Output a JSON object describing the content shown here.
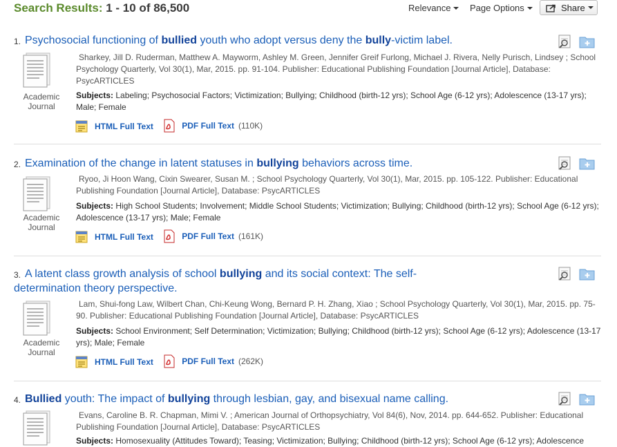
{
  "header": {
    "results_label": "Search Results:",
    "results_range": "1 - 10 of 86,500",
    "relevance": "Relevance",
    "page_options": "Page Options",
    "share": "Share"
  },
  "common": {
    "html_full_text": "HTML Full Text",
    "pdf_full_text": "PDF Full Text",
    "type_line1": "Academic",
    "type_line2": "Journal",
    "subjects_label": "Subjects:"
  },
  "results": [
    {
      "number": "1.",
      "title_parts": [
        "Psychosocial functioning of ",
        "bullied",
        " youth who adopt versus deny the ",
        "bully",
        "-victim label."
      ],
      "meta": "Sharkey, Jill D. Ruderman, Matthew A. Mayworm, Ashley M. Green, Jennifer Greif Furlong, Michael J. Rivera, Nelly Purisch, Lindsey ; School Psychology Quarterly, Vol 30(1), Mar, 2015. pp. 91-104. Publisher: Educational Publishing Foundation [Journal Article], Database: PsycARTICLES",
      "subjects": "Labeling; Psychosocial Factors; Victimization; Bullying; Childhood (birth-12 yrs); School Age (6-12 yrs); Adolescence (13-17 yrs); Male; Female",
      "pdf_size": "(110K)"
    },
    {
      "number": "2.",
      "title_parts": [
        "Examination of the change in latent statuses in ",
        "bullying",
        " behaviors across time.",
        "",
        ""
      ],
      "meta": "Ryoo, Ji Hoon Wang, Cixin Swearer, Susan M. ; School Psychology Quarterly, Vol 30(1), Mar, 2015. pp. 105-122. Publisher: Educational Publishing Foundation [Journal Article], Database: PsycARTICLES",
      "subjects": "High School Students; Involvement; Middle School Students; Victimization; Bullying; Childhood (birth-12 yrs); School Age (6-12 yrs); Adolescence (13-17 yrs); Male; Female",
      "pdf_size": "(161K)"
    },
    {
      "number": "3.",
      "title_parts": [
        "A latent class growth analysis of school ",
        "bullying",
        " and its social context: The self-determination theory perspective.",
        "",
        ""
      ],
      "meta": "Lam, Shui-fong Law, Wilbert Chan, Chi-Keung Wong, Bernard P. H. Zhang, Xiao ; School Psychology Quarterly, Vol 30(1), Mar, 2015. pp. 75-90. Publisher: Educational Publishing Foundation [Journal Article], Database: PsycARTICLES",
      "subjects": "School Environment; Self Determination; Victimization; Bullying; Childhood (birth-12 yrs); School Age (6-12 yrs); Adolescence (13-17 yrs); Male; Female",
      "pdf_size": "(262K)"
    },
    {
      "number": "4.",
      "title_parts": [
        "",
        "Bullied",
        " youth: The impact of ",
        "bullying",
        " through lesbian, gay, and bisexual name calling."
      ],
      "meta": "Evans, Caroline B. R. Chapman, Mimi V. ; American Journal of Orthopsychiatry, Vol 84(6), Nov, 2014. pp. 644-652. Publisher: Educational Publishing Foundation [Journal Article], Database: PsycARTICLES",
      "subjects": "Homosexuality (Attitudes Toward); Teasing; Victimization; Bullying; Childhood (birth-12 yrs); School Age (6-12 yrs); Adolescence",
      "pdf_size": ""
    }
  ]
}
